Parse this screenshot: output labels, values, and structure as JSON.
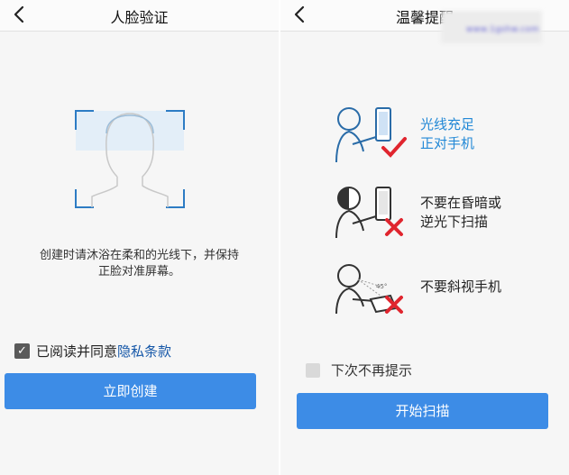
{
  "left": {
    "title": "人脸验证",
    "tip_line1": "创建时请沐浴在柔和的光线下，并保持",
    "tip_line2": "正脸对准屏幕。",
    "agree_text": "已阅读并同意",
    "agree_link": "隐私条款",
    "agree_checked": true,
    "create_button": "立即创建"
  },
  "right": {
    "title": "温馨提醒",
    "watermark_url": "www.1gshw.com",
    "items": [
      {
        "line1": "光线充足",
        "line2": "正对手机",
        "status": "ok"
      },
      {
        "line1": "不要在昏暗或",
        "line2": "逆光下扫描",
        "status": "bad"
      },
      {
        "line1": "不要斜视手机",
        "line2": "",
        "status": "bad",
        "angle_label": "45°"
      }
    ],
    "no_remind_text": "下次不再提示",
    "no_remind_checked": false,
    "scan_button": "开始扫描"
  },
  "colors": {
    "accent": "#3d8ce6",
    "link": "#1557a8",
    "ok_text": "#2288d6",
    "check_mark": "#e0252e",
    "cross_mark": "#e0252e"
  }
}
